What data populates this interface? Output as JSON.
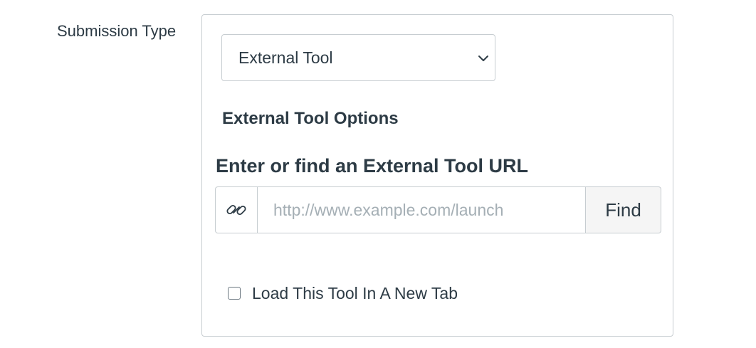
{
  "submission_type": {
    "label": "Submission Type",
    "selected": "External Tool"
  },
  "external_tool": {
    "section_heading": "External Tool Options",
    "url_heading": "Enter or find an External Tool URL",
    "url_value": "",
    "url_placeholder": "http://www.example.com/launch",
    "find_label": "Find",
    "new_tab_label": "Load This Tool In A New Tab",
    "new_tab_checked": false
  },
  "icons": {
    "url_addon": "link-icon",
    "select_caret": "chevron-down-icon"
  },
  "colors": {
    "text": "#2d3b45",
    "border": "#c7cdd1",
    "placeholder": "#a5afb5",
    "button_bg": "#f5f5f5"
  }
}
